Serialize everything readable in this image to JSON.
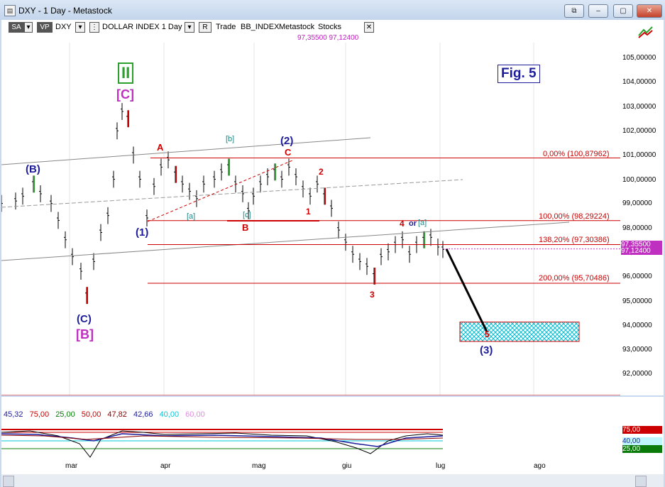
{
  "window": {
    "title": "DXY - 1 Day - Metastock",
    "app_icon": "chart-window-icon",
    "buttons": {
      "restore_alt": "⧉",
      "minimize": "–",
      "maximize": "▢",
      "close": "✕"
    }
  },
  "toolbar": {
    "sa_label": "SA",
    "vp_label": "VP",
    "symbol": "DXY",
    "name_interval": "DOLLAR INDEX 1 Day",
    "mode_label": "R",
    "trade_label": "Trade",
    "source": "BB_INDEX",
    "vendor": "Metastock",
    "type": "Stocks",
    "price1": "97,35500",
    "price2": "97,12400",
    "dropdown_glyph": "▾"
  },
  "figure_label": "Fig. 5",
  "price_axis": {
    "labels": [
      "105,00000",
      "104,00000",
      "103,00000",
      "102,00000",
      "101,00000",
      "100,00000",
      "99,00000",
      "98,00000",
      "97,00000",
      "96,00000",
      "95,00000",
      "94,00000",
      "93,00000",
      "92,00000"
    ],
    "current_badge_top": "97,35500",
    "current_badge": "97,12400"
  },
  "fib_levels": [
    {
      "label": "0,00% (100,87962)",
      "price": 100.87962
    },
    {
      "label": "100,00% (98,29224)",
      "price": 98.29224
    },
    {
      "label": "138,20% (97,30386)",
      "price": 97.30386
    },
    {
      "label": "200,00% (95,70486)",
      "price": 95.70486
    }
  ],
  "wave_labels": {
    "ii": "II",
    "c_bracket": "[C]",
    "b_paren": "(B)",
    "c_paren": "(C)",
    "b_bracket": "[B]",
    "one_paren": "(1)",
    "two_paren": "(2)",
    "three_paren": "(3)",
    "a": "A",
    "b": "B",
    "c": "C",
    "a_small": "[a]",
    "b_small": "[b]",
    "c_small": "[c]",
    "w1": "1",
    "w2": "2",
    "w3": "3",
    "w4": "4",
    "or_label": "or",
    "a_alt": "[a]",
    "w5": "5"
  },
  "time_axis": [
    "mar",
    "apr",
    "mag",
    "giu",
    "lug",
    "ago"
  ],
  "indicator": {
    "values": [
      {
        "text": "45,32",
        "color": "#1c1c9c"
      },
      {
        "text": "75,00",
        "color": "#cc0000"
      },
      {
        "text": "25,00",
        "color": "#0a7a0a"
      },
      {
        "text": "50,00",
        "color": "#cc0000"
      },
      {
        "text": "47,82",
        "color": "#880000"
      },
      {
        "text": "42,66",
        "color": "#1c1c9c"
      },
      {
        "text": "40,00",
        "color": "#00c8d8"
      },
      {
        "text": "60,00",
        "color": "#e08ce0"
      }
    ],
    "axis_labels": [
      "75,00",
      "40,00",
      "25,00"
    ]
  },
  "colors": {
    "fib": "#cc0000",
    "up_bar": "#2ca02c",
    "down_bar": "#cc0000",
    "magenta": "#c030c0",
    "wave_blue": "#1c1c9c",
    "target_box": "#00bcd4"
  },
  "chart_data": {
    "type": "candlestick",
    "x": [
      "mar",
      "apr",
      "mag",
      "giu",
      "lug",
      "ago"
    ],
    "ylim": [
      91.0,
      106.0
    ],
    "levels": [
      100.87962,
      98.29224,
      97.30386,
      95.70486
    ],
    "current_price": 97.124,
    "projection": {
      "from_price": 97.12,
      "to_price": 93.7
    },
    "target_zone": [
      93.3,
      94.1
    ]
  }
}
